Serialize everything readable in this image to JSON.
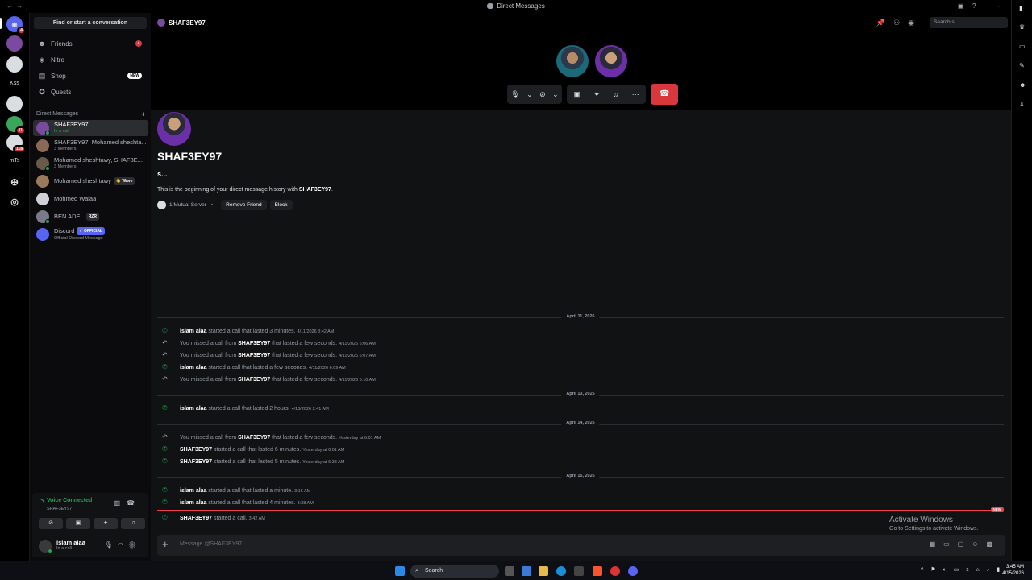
{
  "window": {
    "title": "Direct Messages"
  },
  "rail": {
    "servers": [
      {
        "label": "",
        "badge": "4",
        "color": "#5865f2"
      },
      {
        "label": "",
        "badge": "",
        "color": "#7a4a9e"
      },
      {
        "label": "",
        "badge": "",
        "color": "#dbdee1"
      },
      {
        "label": "Kss",
        "badge": "",
        "color": ""
      },
      {
        "label": "",
        "badge": "",
        "color": "#dbdee1"
      },
      {
        "label": "",
        "badge": "11",
        "color": "#3ba55c"
      },
      {
        "label": "",
        "badge": "118",
        "color": "#dbdee1"
      },
      {
        "label": "mTs",
        "badge": "",
        "color": ""
      }
    ]
  },
  "sidebar": {
    "find_placeholder": "Find or start a conversation",
    "nav": [
      {
        "label": "Friends",
        "badge": "4"
      },
      {
        "label": "Nitro"
      },
      {
        "label": "Shop",
        "tag": "NEW"
      },
      {
        "label": "Quests"
      }
    ],
    "dm_header": "Direct Messages",
    "dms": [
      {
        "name": "SHAF3EY97",
        "sub": "In a call",
        "active": true,
        "color": "#7a4a9e"
      },
      {
        "name": "SHAF3EY97, Mohamed sheshta...",
        "sub": "3 Members",
        "color": "#8a6a55"
      },
      {
        "name": "Mohamed sheshtawy, SHAF3E...",
        "sub": "3 Members",
        "color": "#6a5a4a"
      },
      {
        "name": "Mohamed sheshtawy",
        "sub": "",
        "tag": "Wave",
        "color": "#9a7a5a"
      },
      {
        "name": "Mohmed Walaa",
        "sub": "",
        "color": "#d0d0d8"
      },
      {
        "name": "BEN ADEL",
        "sub": "",
        "tag": "RZR",
        "color": "#7a7a8a"
      },
      {
        "name": "Discord",
        "sub": "Official Discord Message",
        "tag": "OFFICIAL",
        "color": "#5865f2"
      }
    ]
  },
  "voice": {
    "status": "Voice Connected",
    "channel": "SHAF3EY97"
  },
  "user": {
    "name": "islam alaa",
    "status": "In a call"
  },
  "chat": {
    "header_name": "SHAF3EY97",
    "search_placeholder": "Search s...",
    "intro_name": "SHAF3EY97",
    "intro_sub": "s...",
    "intro_desc_prefix": "This is the beginning of your direct message history with ",
    "intro_desc_name": "SHAF3EY97",
    "intro_desc_suffix": ".",
    "mutual": "1 Mutual Server",
    "remove_friend": "Remove Friend",
    "block": "Block",
    "composer_placeholder": "Message @SHAF3EY97"
  },
  "dividers": [
    "April 11, 2026",
    "April 13, 2026",
    "April 14, 2026",
    "April 15, 2026"
  ],
  "messages": [
    {
      "type": "ok",
      "who": "islam alaa",
      "own": false,
      "text": " started a call that lasted 3 minutes.",
      "ts": "4/11/2026 3:42 AM"
    },
    {
      "type": "miss",
      "pre": "You missed a call from ",
      "who": "SHAF3EY97",
      "text": " that lasted a few seconds.",
      "ts": "4/11/2026 6:06 AM"
    },
    {
      "type": "miss",
      "pre": "You missed a call from ",
      "who": "SHAF3EY97",
      "text": " that lasted a few seconds.",
      "ts": "4/11/2026 6:07 AM"
    },
    {
      "type": "ok",
      "who": "islam alaa",
      "text": " started a call that lasted a few seconds.",
      "ts": "4/11/2026 6:09 AM"
    },
    {
      "type": "miss",
      "pre": "You missed a call from ",
      "who": "SHAF3EY97",
      "text": " that lasted a few seconds.",
      "ts": "4/11/2026 6:10 AM"
    },
    {
      "type": "ok",
      "who": "islam alaa",
      "text": " started a call that lasted 2 hours.",
      "ts": "4/13/2026 2:41 AM"
    },
    {
      "type": "miss",
      "pre": "You missed a call from ",
      "who": "SHAF3EY97",
      "text": " that lasted a few seconds.",
      "ts": "Yesterday at 6:01 AM"
    },
    {
      "type": "ok",
      "who": "SHAF3EY97",
      "text": " started a call that lasted 6 minutes.",
      "ts": "Yesterday at 6:01 AM"
    },
    {
      "type": "ok",
      "who": "SHAF3EY97",
      "text": " started a call that lasted 5 minutes.",
      "ts": "Yesterday at 6:38 AM"
    },
    {
      "type": "ok",
      "who": "islam alaa",
      "text": " started a call that lasted a minute.",
      "ts": "3:16 AM"
    },
    {
      "type": "ok",
      "who": "islam alaa",
      "text": " started a call that lasted 4 minutes.",
      "ts": "3:38 AM"
    },
    {
      "type": "ok",
      "who": "SHAF3EY97",
      "text": " started a call.",
      "ts": "3:42 AM"
    }
  ],
  "new_tag": "NEW",
  "activate": {
    "line1": "Activate Windows",
    "line2": "Go to Settings to activate Windows."
  },
  "taskbar": {
    "search": "Search",
    "time": "3:45 AM",
    "date": "4/15/2026"
  },
  "colors": {
    "accent": "#5865f2",
    "green": "#23a55a",
    "red": "#da373c"
  }
}
